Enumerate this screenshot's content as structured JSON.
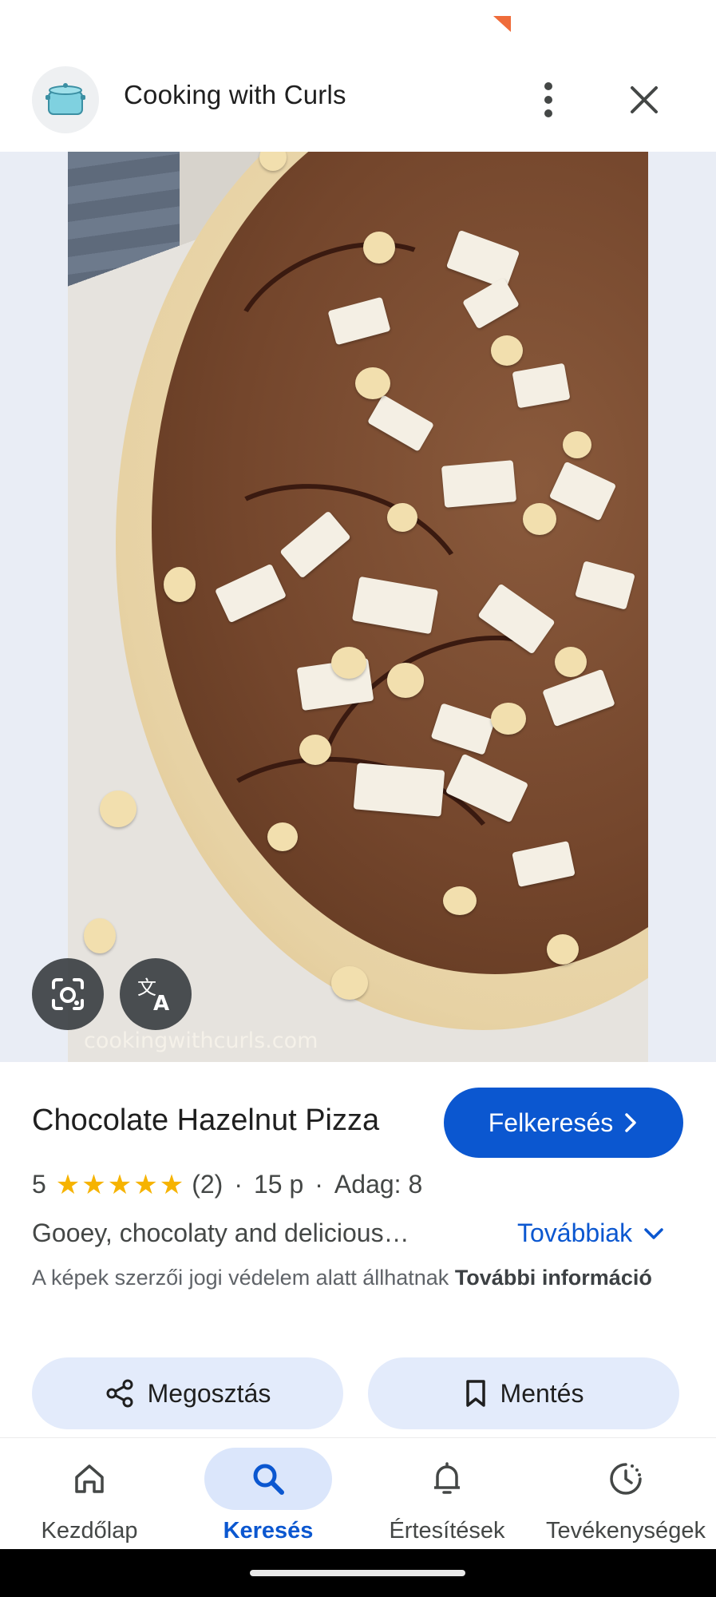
{
  "header": {
    "site_title": "Cooking with Curls",
    "logo_icon": "cooking-pot-icon",
    "more_icon": "more-vertical-icon",
    "close_icon": "close-icon"
  },
  "image": {
    "watermark": "cookingwithcurls.com",
    "lens_icon": "lens-camera-icon",
    "translate_icon": "translate-icon"
  },
  "recipe": {
    "title": "Chocolate Hazelnut Pizza",
    "visit_label": "Felkeresés",
    "rating": "5",
    "stars": 5,
    "review_count": "(2)",
    "time": "15 p",
    "servings": "Adag: 8",
    "description": "Gooey, chocolaty and delicious…",
    "more_label": "Továbbiak",
    "copyright_text": "A képek szerzői jogi védelem alatt állhatnak",
    "copyright_link": "További információ",
    "share_label": "Megosztás",
    "save_label": "Mentés"
  },
  "bottom_nav": {
    "items": [
      {
        "label": "Kezdőlap",
        "icon": "home-icon",
        "active": false
      },
      {
        "label": "Keresés",
        "icon": "search-icon",
        "active": true
      },
      {
        "label": "Értesítések",
        "icon": "bell-icon",
        "active": false
      },
      {
        "label": "Tevékenységek",
        "icon": "activity-icon",
        "active": false
      }
    ]
  },
  "colors": {
    "accent": "#0b57d0",
    "star": "#f6b300",
    "pill_bg": "#e3ebfb"
  }
}
